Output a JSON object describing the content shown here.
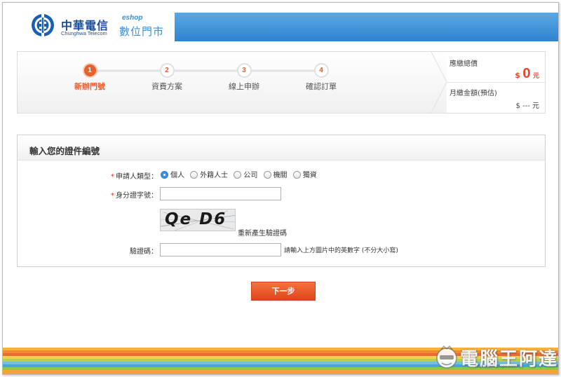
{
  "header": {
    "logo_zh": "中華電信",
    "logo_en": "Chunghwa Telecom",
    "eshop_small": "eshop",
    "eshop_big": "數位門市",
    "colors": {
      "bar": "#2f84cf",
      "brand": "#1b4f9c"
    }
  },
  "steps": [
    {
      "num": "1",
      "label": "新辦門號",
      "active": true
    },
    {
      "num": "2",
      "label": "資費方案",
      "active": false
    },
    {
      "num": "3",
      "label": "線上申辦",
      "active": false
    },
    {
      "num": "4",
      "label": "確認訂單",
      "active": false
    }
  ],
  "price": {
    "total_label": "應繳總價",
    "total_currency": "$",
    "total_value": "0",
    "total_unit": "元",
    "monthly_label": "月繳金額(預估)",
    "monthly_value": "$ --- 元"
  },
  "form": {
    "title": "輸入您的證件編號",
    "applicant_type": {
      "required_mark": "*",
      "label": "申請人類型：",
      "options": [
        "個人",
        "外籍人士",
        "公司",
        "機關",
        "獨資"
      ],
      "selected": "個人"
    },
    "id_number": {
      "required_mark": "*",
      "label": "身分證字號：",
      "value": ""
    },
    "captcha": {
      "text": "Qe D6",
      "regenerate_label": "重新產生驗證碼",
      "label": "驗證碼：",
      "value": "",
      "hint": "請輸入上方圖片中的英數字 (不分大小寫)"
    }
  },
  "next_button": {
    "label": "下一步",
    "color": "#e8502a"
  },
  "watermark": {
    "text": "電腦王阿達",
    "url": "http://www.kocpc.com.tw"
  },
  "footer_colors": [
    "#f6b23a",
    "#f08a2a",
    "#e86a34",
    "#f5d04c",
    "#b6d24a",
    "#6fc3d8",
    "#4aa3d8",
    "#8ac84e",
    "#f2a43b"
  ]
}
